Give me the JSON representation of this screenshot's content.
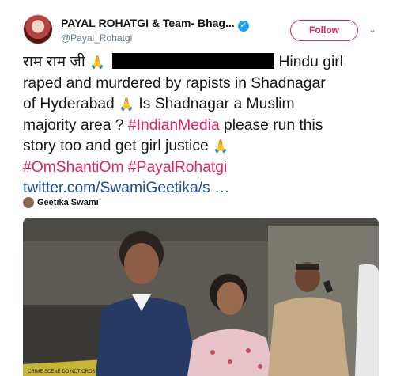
{
  "author": {
    "display_name": "PAYAL ROHATGI & Team- Bhag...",
    "handle": "@Payal_Rohatgi",
    "verified_icon": "verified-badge-icon"
  },
  "actions": {
    "follow_label": "Follow",
    "menu_icon": "chevron-down-icon"
  },
  "tweet": {
    "line1_start": "राम राम जी",
    "line1_end": "Hindu girl",
    "line2": "raped and murdered by rapists in  Shadnagar",
    "line3_start": "of Hyderabad",
    "line3_end": "Is Shadnagar a Muslim",
    "line4_start": "majority area ?",
    "line4_hashtag": "#IndianMedia",
    "line4_end": "please run this",
    "line5": "story too and get girl justice",
    "hashtag_1": "#OmShantiOm",
    "hashtag_2": "#PayalRohatgi",
    "link": "twitter.com/SwamiGeetika/s …",
    "emoji": "🙏"
  },
  "media": {
    "credit_name": "Geetika Swami",
    "tape_text": "CRIME SCENE DO NOT CROSS"
  },
  "colors": {
    "hashtag": "#e0245e",
    "link": "#1d4ea0",
    "follow": "#e0245e",
    "verified": "#1da1f2"
  }
}
